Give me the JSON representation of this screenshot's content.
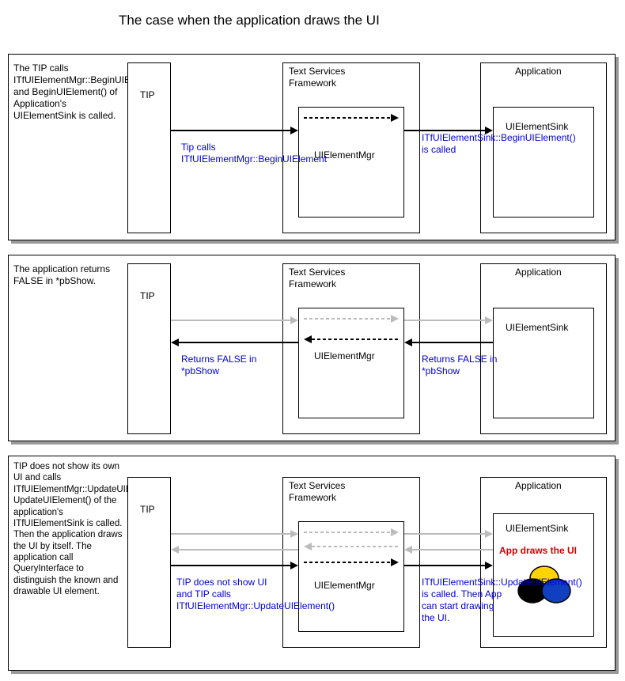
{
  "title": "The case when the application draws the UI",
  "common": {
    "tip": "TIP",
    "tsf": "Text Services Framework",
    "uielementmgr": "UIElementMgr",
    "application": "Application",
    "uielementsink": "UIElementSink"
  },
  "panel1": {
    "desc": "The TIP calls ITfUIElementMgr::BeginUIElement() and BeginUIElement() of Application's UIElementSink is called.",
    "caption_left": "Tip calls ITfUIElementMgr::BeginUIElement",
    "caption_right": "ITfUIElementSink::BeginUIElement() is called"
  },
  "panel2": {
    "desc": "The application returns FALSE in *pbShow.",
    "caption_left": "Returns FALSE in *pbShow",
    "caption_right": "Returns FALSE in *pbShow"
  },
  "panel3": {
    "desc": "TIP does not show its own UI and calls ITfUIElementMgr::UpdateUIElement(). UpdateUIElement() of the application's ITfUIElementSink is called. Then the application draws the UI by itself. The application call QueryInterface to distinguish the known and drawable UI element.",
    "caption_left": "TIP does not show UI and TIP calls ITfUIElementMgr::UpdateUIElement()",
    "caption_right": "ITfUIElementSink::UpdateUIElement() is called. Then App can start drawing the UI.",
    "app_draws": "App draws the UI"
  }
}
